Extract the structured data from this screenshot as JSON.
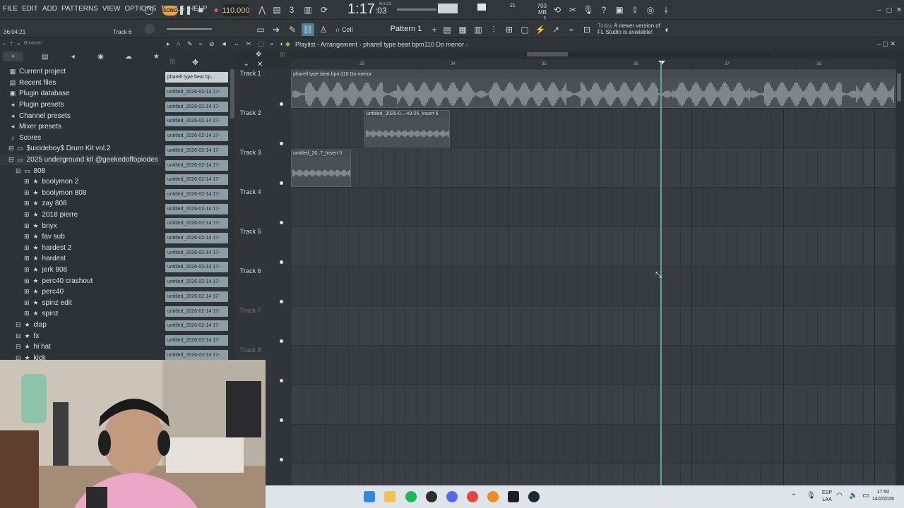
{
  "menu": [
    "FILE",
    "EDIT",
    "ADD",
    "PATTERNS",
    "VIEW",
    "OPTIONS",
    "TOOLS",
    "HELP"
  ],
  "transport": {
    "song_badge": "SONG",
    "tempo": "110.000",
    "time_main": "1:17",
    "time_sub": ":03",
    "time_unit": "M:S:CS",
    "cpu_line1": "703 MB",
    "cpu_line2": "1",
    "cpu_num": "21"
  },
  "toolbar2": {
    "clock": "36:04:21",
    "track_hint": "Track 6",
    "cell": "Cell",
    "pattern": "Pattern 1",
    "news_today": "Today",
    "news_text": "A newer version of FL Studio is available!"
  },
  "browser": {
    "header": "Browser",
    "items": [
      {
        "label": "Current project",
        "icon": "▦",
        "level": 0
      },
      {
        "label": "Recent files",
        "icon": "▤",
        "level": 0
      },
      {
        "label": "Plugin database",
        "icon": "▣",
        "level": 0
      },
      {
        "label": "Plugin presets",
        "icon": "◂",
        "level": 0
      },
      {
        "label": "Channel presets",
        "icon": "◂",
        "level": 0
      },
      {
        "label": "Mixer presets",
        "icon": "◂",
        "level": 0
      },
      {
        "label": "Scores",
        "icon": "♪",
        "level": 0
      },
      {
        "label": "$uicideboy$ Drum Kit vol.2",
        "icon": "▭",
        "level": 0
      },
      {
        "label": "2025 underground kit @geekedoffopiodes",
        "icon": "▭",
        "level": 0
      },
      {
        "label": "808",
        "icon": "▭",
        "level": 1
      },
      {
        "label": "boolymon 2",
        "icon": "★",
        "level": 2
      },
      {
        "label": "boolymon 808",
        "icon": "★",
        "level": 2
      },
      {
        "label": "zay 808",
        "icon": "★",
        "level": 2
      },
      {
        "label": "2018 pierre",
        "icon": "★",
        "level": 2
      },
      {
        "label": "bnyx",
        "icon": "★",
        "level": 2
      },
      {
        "label": "fav sub",
        "icon": "★",
        "level": 2
      },
      {
        "label": "hardest 2",
        "icon": "★",
        "level": 2
      },
      {
        "label": "hardest",
        "icon": "★",
        "level": 2
      },
      {
        "label": "jerk 808",
        "icon": "★",
        "level": 2
      },
      {
        "label": "perc40 crashout",
        "icon": "★",
        "level": 2
      },
      {
        "label": "perc40",
        "icon": "★",
        "level": 2
      },
      {
        "label": "spinz edit",
        "icon": "★",
        "level": 2
      },
      {
        "label": "spinz",
        "icon": "★",
        "level": 2
      },
      {
        "label": "clap",
        "icon": "★",
        "level": 1
      },
      {
        "label": "fx",
        "icon": "★",
        "level": 1
      },
      {
        "label": "hi hat",
        "icon": "★",
        "level": 1
      },
      {
        "label": "kick",
        "icon": "★",
        "level": 1
      }
    ]
  },
  "patterns": {
    "top": "pharell type beat bp...",
    "items": [
      "untitled_2026-02-14 17-",
      "untitled_2026-02-14 17-",
      "untitled_2026-02-14 17-",
      "untitled_2026-02-14 17-",
      "untitled_2026-02-14 17-",
      "untitled_2026-02-14 17-",
      "untitled_2026-02-14 17-",
      "untitled_2026-02-14 17-",
      "untitled_2026-02-14 17-",
      "untitled_2026-02-14 17-",
      "untitled_2026-02-14 17-",
      "untitled_2026-02-14 17-",
      "untitled_2026-02-14 17-",
      "untitled_2026-02-14 17-",
      "untitled_2026-02-14 17-",
      "untitled_2026-02-14 17-",
      "untitled_2026-02-14 17-",
      "untitled_2026-02-14 17-",
      "untitled_2026-02-14 17-",
      "untitled_2026-02-14 17-"
    ]
  },
  "playlist": {
    "title": "Playlist - Arrangement",
    "crumb": "pharell type beat bpm110 Do menor",
    "ruler": [
      "33",
      "34",
      "35",
      "36",
      "37",
      "38"
    ],
    "tracks": [
      {
        "name": "Track 1",
        "dim": false
      },
      {
        "name": "Track 2",
        "dim": false
      },
      {
        "name": "Track 3",
        "dim": false
      },
      {
        "name": "Track 4",
        "dim": false
      },
      {
        "name": "Track 5",
        "dim": false
      },
      {
        "name": "Track 6",
        "dim": false
      },
      {
        "name": "Track 7",
        "dim": true
      },
      {
        "name": "Track 8",
        "dim": true
      },
      {
        "name": "",
        "dim": false
      },
      {
        "name": "",
        "dim": false
      },
      {
        "name": "",
        "dim": false
      }
    ],
    "clips": [
      {
        "label": "pharell type beat bpm110 Do menor",
        "track": 0
      },
      {
        "label": "untitled_2026-0...-49-26_Insert 5",
        "track": 1
      },
      {
        "label": "untitled_20..7_Insert 5",
        "track": 2
      }
    ]
  },
  "taskbar": {
    "lang1": "ESP",
    "lang2": "LAA",
    "time": "17:50",
    "date": "14/2/2026"
  },
  "colors": {
    "accent": "#5fa596",
    "clip": "#4a5055",
    "pattern_item": "#8d9da6"
  }
}
